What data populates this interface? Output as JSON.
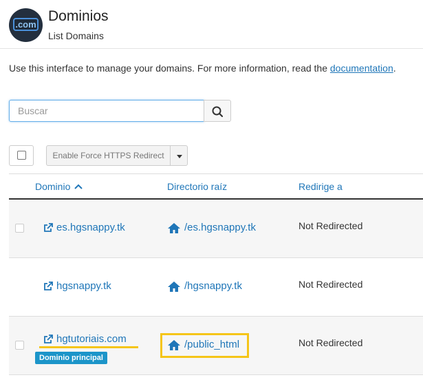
{
  "header": {
    "logo_text": ".com",
    "title": "Dominios",
    "subtitle": "List Domains"
  },
  "intro": {
    "text": "Use this interface to manage your domains. For more information, read the ",
    "link": "documentation",
    "end": "."
  },
  "search": {
    "placeholder": "Buscar"
  },
  "toolbar": {
    "force_https_label": "Enable Force HTTPS Redirect"
  },
  "table": {
    "columns": {
      "domain": "Dominio",
      "docroot": "Directorio raíz",
      "redirect": "Redirige a"
    },
    "sort": {
      "column": "domain",
      "direction": "ascending"
    },
    "rows": [
      {
        "domain": "es.hgsnappy.tk",
        "docroot": "/es.hgsnappy.tk",
        "redirect": "Not Redirected",
        "has_checkbox": true,
        "badge": ""
      },
      {
        "domain": "hgsnappy.tk",
        "docroot": "/hgsnappy.tk",
        "redirect": "Not Redirected",
        "has_checkbox": false,
        "badge": ""
      },
      {
        "domain": "hgtutoriais.com",
        "docroot": "/public_html",
        "redirect": "Not Redirected",
        "has_checkbox": true,
        "badge": "Dominio principal"
      }
    ]
  },
  "colors": {
    "link": "#1f76b8",
    "badge": "#1c95c9",
    "highlight": "#f5c518"
  }
}
